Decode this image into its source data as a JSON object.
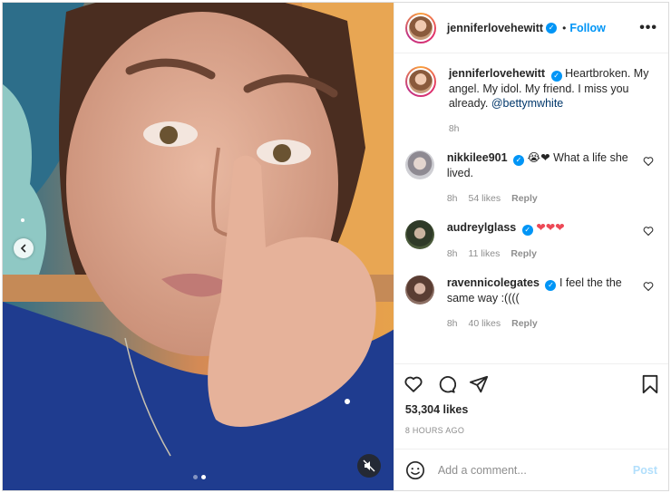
{
  "author": {
    "username": "jenniferlovehewitt",
    "verified_badge": "✓",
    "bullet": "•",
    "follow_label": "Follow",
    "more_label": "•••"
  },
  "caption": {
    "username": "jenniferlovehewitt",
    "text": "Heartbroken. My angel. My idol. My friend. I miss you already.",
    "mention": "@bettymwhite",
    "time": "8h"
  },
  "comments": [
    {
      "username": "nikkilee901",
      "text": "😭❤ What a life she lived.",
      "time": "8h",
      "likes": "54 likes",
      "reply": "Reply",
      "avatar_color": "#b7b7bf"
    },
    {
      "username": "audreylglass",
      "text": "❤❤❤",
      "time": "8h",
      "likes": "11 likes",
      "reply": "Reply",
      "avatar_color": "#3a4030"
    },
    {
      "username": "ravennicolegates",
      "text": "I feel the the same way :((((",
      "time": "8h",
      "likes": "40 likes",
      "reply": "Reply",
      "avatar_color": "#6b5045"
    }
  ],
  "stats": {
    "likes": "53,304 likes",
    "posted": "8 HOURS AGO"
  },
  "add_comment": {
    "placeholder": "Add a comment...",
    "post_label": "Post"
  },
  "media": {
    "carousel_index": 2,
    "carousel_count": 2
  },
  "colors": {
    "accent": "#0095f6",
    "heart_red": "#ed4956",
    "mention": "#00376b"
  }
}
